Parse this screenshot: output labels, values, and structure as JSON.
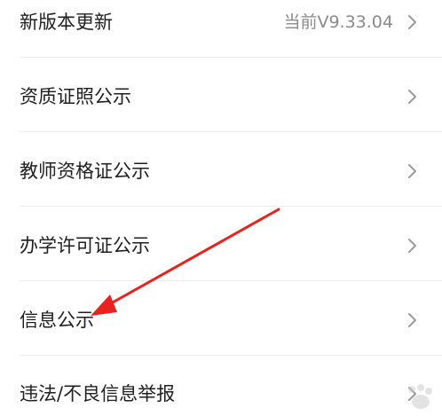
{
  "settings_list": {
    "items": [
      {
        "label": "新版本更新",
        "value": "当前V9.33.04"
      },
      {
        "label": "资质证照公示",
        "value": ""
      },
      {
        "label": "教师资格证公示",
        "value": ""
      },
      {
        "label": "办学许可证公示",
        "value": ""
      },
      {
        "label": "信息公示",
        "value": ""
      },
      {
        "label": "违法/不良信息举报",
        "value": ""
      }
    ]
  },
  "annotation": {
    "arrow_color": "#e8231f"
  },
  "icons": {
    "chevron": "chevron-right-icon"
  }
}
